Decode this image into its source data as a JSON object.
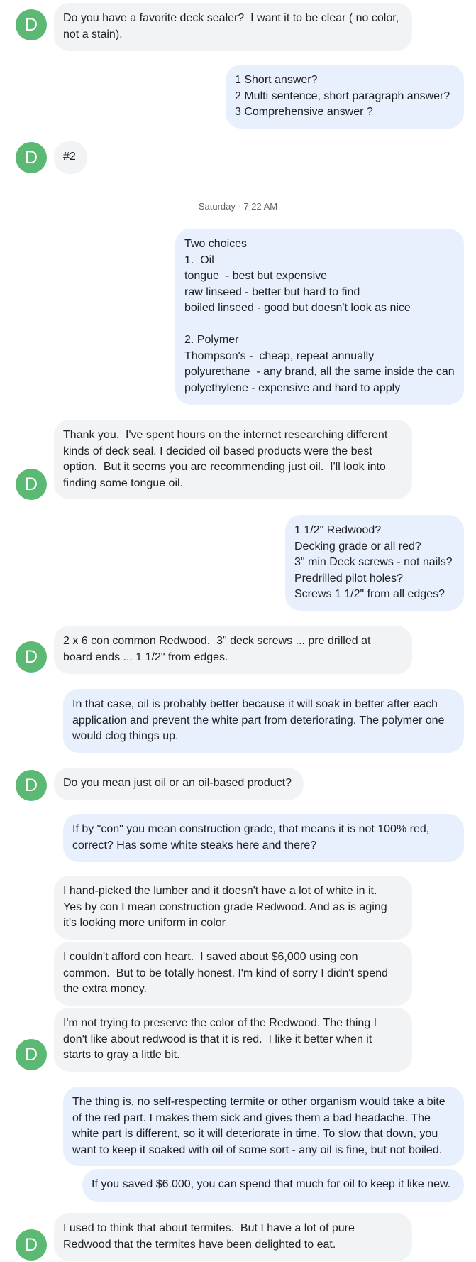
{
  "colors": {
    "incoming_bubble": "#f1f3f4",
    "outgoing_bubble": "#e8f0fe",
    "avatar": "#5bb974",
    "avatar_text": "#ffffff",
    "timestamp": "#5f6368"
  },
  "contact": {
    "avatar_letter": "D"
  },
  "timestamp": "Saturday · 7:22 AM",
  "messages": [
    {
      "dir": "in",
      "lines": [
        "Do you have a favorite deck sealer?  I want it to be clear ( no color,",
        "not a stain)."
      ]
    },
    {
      "dir": "out",
      "lines": [
        "1 Short answer?",
        "2 Multi sentence, short paragraph answer?",
        "3 Comprehensive answer ?"
      ]
    },
    {
      "dir": "in",
      "lines": [
        "#2"
      ]
    },
    {
      "dir": "out",
      "lines": [
        "Two choices",
        "1.  Oil",
        "tongue  - best but expensive",
        "raw linseed - better but hard to find",
        "boiled linseed - good but doesn't look as nice",
        "",
        "2. Polymer",
        "Thompson's -  cheap, repeat annually",
        "polyurethane  - any brand, all the same inside the can",
        "polyethylene - expensive and hard to apply"
      ]
    },
    {
      "dir": "in",
      "lines": [
        "Thank you.  I've spent hours on the internet researching different",
        "kinds of deck seal. I decided oil based products were the best",
        "option.  But it seems you are recommending just oil.  I'll look into",
        "finding some tongue oil."
      ]
    },
    {
      "dir": "out",
      "lines": [
        "1 1/2\" Redwood?",
        "Decking grade or all red?",
        "3\" min Deck screws - not nails?",
        "Predrilled pilot holes?",
        "Screws 1 1/2\" from all edges?"
      ]
    },
    {
      "dir": "in",
      "lines": [
        "2 x 6 con common Redwood.  3\" deck screws ... pre drilled at",
        "board ends ... 1 1/2\" from edges."
      ]
    },
    {
      "dir": "out",
      "lines": [
        "In that case, oil is probably better because it will soak in better after each",
        "application and prevent the white part from deteriorating. The polymer one",
        "would clog things up."
      ]
    },
    {
      "dir": "in",
      "lines": [
        "Do you mean just oil or an oil-based product?"
      ]
    },
    {
      "dir": "out",
      "lines": [
        "If by \"con\" you mean construction grade, that means it is not 100% red,",
        "correct? Has some white steaks here and there?"
      ]
    },
    {
      "dir": "in",
      "lines": [
        "I hand-picked the lumber and it doesn't have a lot of white in it.",
        "Yes by con I mean construction grade Redwood. And as is aging",
        "it's looking more uniform in color"
      ]
    },
    {
      "dir": "in",
      "lines": [
        "I couldn't afford con heart.  I saved about $6,000 using con",
        "common.  But to be totally honest, I'm kind of sorry I didn't spend",
        "the extra money."
      ]
    },
    {
      "dir": "in",
      "lines": [
        "I'm not trying to preserve the color of the Redwood. The thing I",
        "don't like about redwood is that it is red.  I like it better when it",
        "starts to gray a little bit."
      ]
    },
    {
      "dir": "out",
      "lines": [
        "The thing is, no self-respecting termite or other organism would take a bite",
        "of the red part. I makes them sick and gives them a bad headache. The",
        "white part is different, so it will deteriorate in time. To slow that down, you",
        "want to keep it soaked with oil of some sort - any oil is fine, but not boiled."
      ]
    },
    {
      "dir": "out",
      "lines": [
        "If you saved $6.000, you can spend that much for oil to keep it like new."
      ]
    },
    {
      "dir": "in",
      "lines": [
        "I used to think that about termites.  But I have a lot of pure",
        "Redwood that the termites have been delighted to eat."
      ]
    }
  ]
}
